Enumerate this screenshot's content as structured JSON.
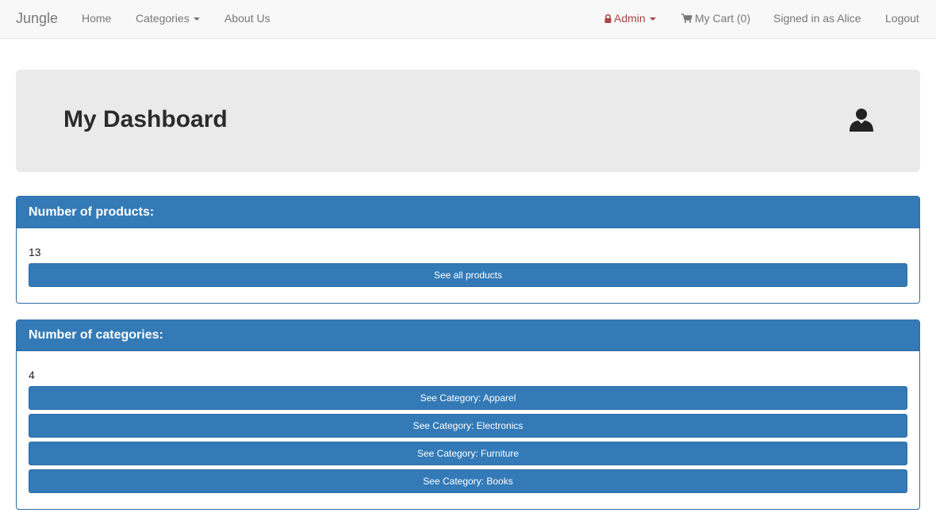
{
  "nav": {
    "brand": "Jungle",
    "home": "Home",
    "categories": "Categories",
    "about": "About Us",
    "admin": "Admin",
    "cart": "My Cart (0)",
    "signed_in": "Signed in as Alice",
    "logout": "Logout"
  },
  "dashboard": {
    "title": "My Dashboard"
  },
  "products_panel": {
    "heading": "Number of products:",
    "count": "13",
    "button": "See all products"
  },
  "categories_panel": {
    "heading": "Number of categories:",
    "count": "4",
    "buttons": [
      "See Category: Apparel",
      "See Category: Electronics",
      "See Category: Furniture",
      "See Category: Books"
    ]
  },
  "colors": {
    "primary": "#337ab7",
    "admin": "#a94442",
    "jumbotron": "#eaeaea",
    "navbar": "#f8f8f8"
  },
  "icons": {
    "admin": "lock-icon",
    "cart": "cart-icon",
    "profile": "user-icon"
  }
}
